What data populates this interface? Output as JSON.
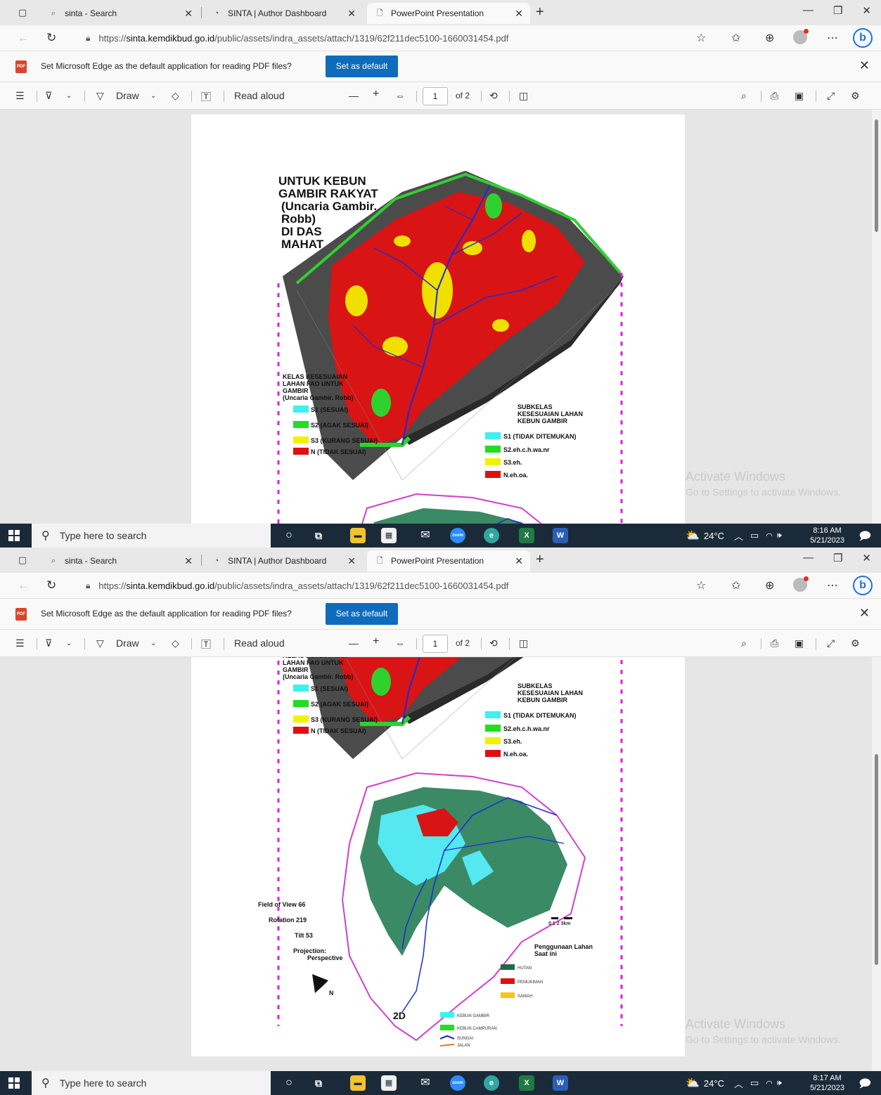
{
  "browser": {
    "tabs": [
      {
        "label": "sinta - Search",
        "icon": "search-icon"
      },
      {
        "label": "SINTA | Author Dashboard",
        "icon": "sinta-icon"
      },
      {
        "label": "PowerPoint Presentation",
        "icon": "page-icon"
      }
    ],
    "url_prefix": "https://",
    "url_domain": "sinta.kemdikbud.go.id",
    "url_path": "/public/assets/indra_assets/attach/1319/62f211dec5100-1660031454.pdf"
  },
  "infobar": {
    "message": "Set Microsoft Edge as the default application for reading PDF files?",
    "button": "Set as default"
  },
  "pdf_toolbar": {
    "draw": "Draw",
    "read_aloud": "Read aloud",
    "page": "1",
    "of_pages": "of 2"
  },
  "map": {
    "title_lines": [
      "UNTUK KEBUN",
      "GAMBIR RAKYAT",
      "(Uncaria Gambir.",
      "Robb)",
      "DI DAS",
      "MAHAT"
    ],
    "legend_left_title": [
      "KELAS KESESUAIAN",
      "LAHAN FAO UNTUK",
      "GAMBIR",
      "(Uncaria Gambir. Robb)"
    ],
    "legend_left_items": [
      {
        "label": "S1 (SESUAI)",
        "color": "#3ff0f0"
      },
      {
        "label": "S2 (AGAK SESUAI)",
        "color": "#22dd22"
      },
      {
        "label": "S3 (KURANG SESUAI)",
        "color": "#f2f200"
      },
      {
        "label": "N (TIDAK SESUAI)",
        "color": "#e01010"
      }
    ],
    "legend_right_title": [
      "SUBKELAS",
      "KESESUAIAN LAHAN",
      "KEBUN GAMBIR"
    ],
    "legend_right_items": [
      {
        "label": "S1 (TIDAK DITEMUKAN)",
        "color": "#3ff0f0"
      },
      {
        "label": "S2.eh.c.h.wa.nr",
        "color": "#22dd22"
      },
      {
        "label": "S3.eh.",
        "color": "#f2f200"
      },
      {
        "label": "N.eh.oa.",
        "color": "#e01010"
      }
    ],
    "view_params": [
      "Field of View 66",
      "Rotation 219",
      "Tilt 53",
      "Projection:",
      "Perspective"
    ],
    "scale_label": "0  1  2   3km",
    "landuse_title": [
      "Penggunaan Lahan",
      "Saat ini"
    ],
    "landuse_items": [
      {
        "label": "HUTAN",
        "color": "#1f6b45"
      },
      {
        "label": "PEMUKIMAN",
        "color": "#e01010"
      },
      {
        "label": "SAWAH",
        "color": "#f5c518"
      },
      {
        "label": "KEBUN GAMBIR",
        "color": "#3ff0f0"
      },
      {
        "label": "KEBUN CAMPURAN",
        "color": "#22dd22"
      },
      {
        "label": "SUNGAI",
        "color": "#1020c0"
      },
      {
        "label": "JALAN",
        "color": "#e07a20"
      }
    ],
    "label_2d": "2D"
  },
  "watermark": {
    "line1": "Activate Windows",
    "line2": "Go to Settings to activate Windows."
  },
  "taskbar": {
    "search_placeholder": "Type here to search",
    "temperature": "24°C"
  },
  "screens": [
    {
      "time": "8:16 AM",
      "date": "5/21/2023"
    },
    {
      "time": "8:17 AM",
      "date": "5/21/2023"
    }
  ]
}
